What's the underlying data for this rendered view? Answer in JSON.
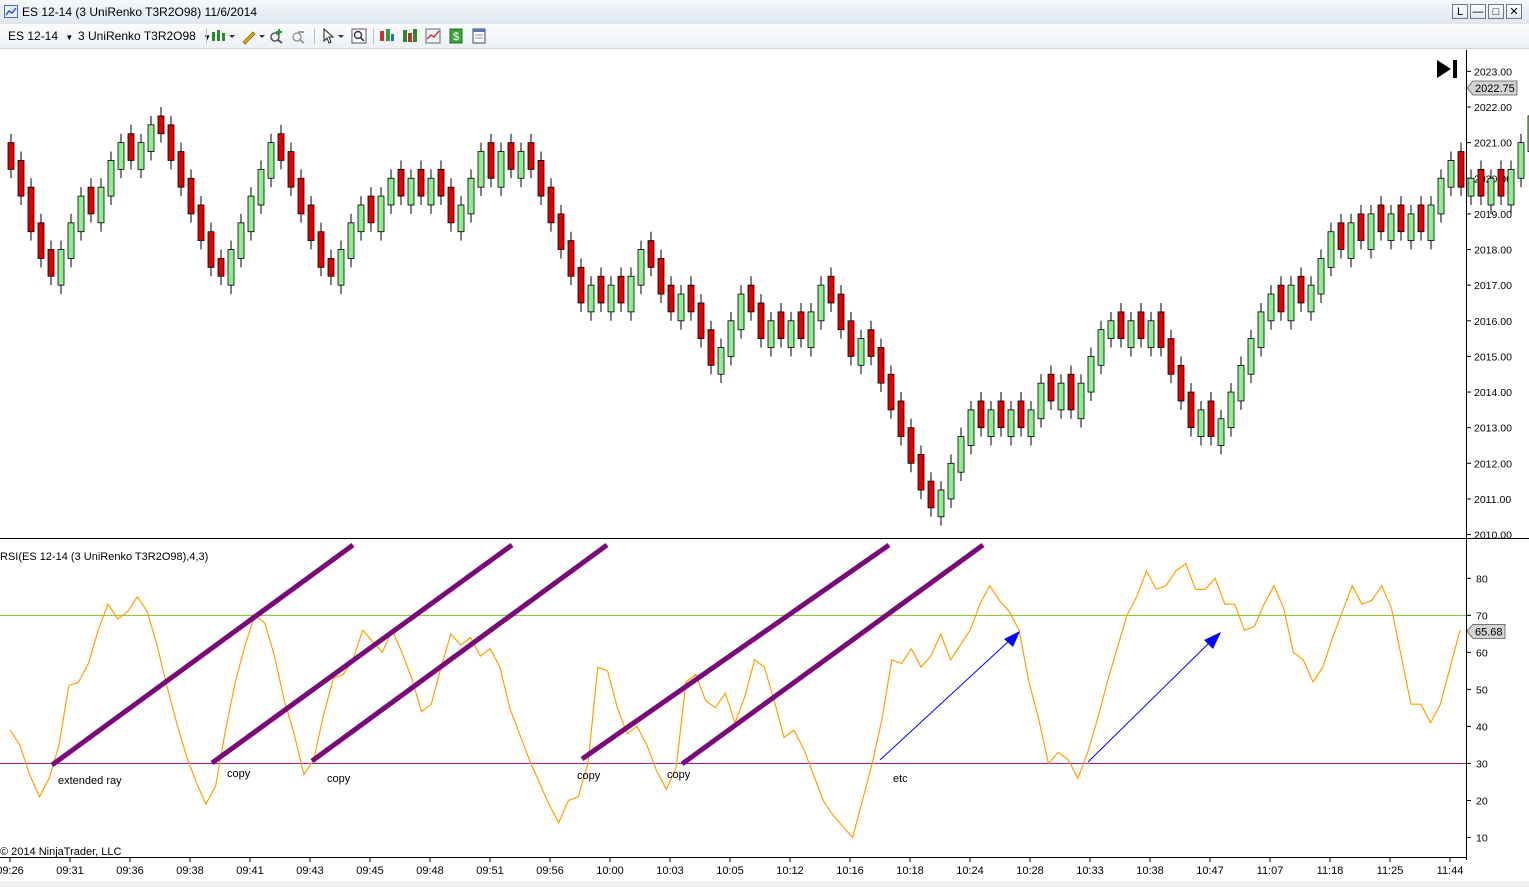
{
  "window": {
    "title": "ES 12-14 (3 UniRenko T3R2O98)  11/6/2014",
    "buttons": [
      "L",
      "—",
      "□",
      "✕"
    ]
  },
  "toolbar": {
    "instrument": "ES 12-14",
    "bar_type": "3 UniRenko T3R2O98",
    "icons": [
      "chart-style-icon",
      "drawing-pencil-icon",
      "zoom-in-icon",
      "zoom-out-icon",
      "pointer-icon",
      "properties-icon",
      "data-box-icon",
      "indicators-icon",
      "strategies-icon",
      "dollar-icon",
      "templates-icon"
    ]
  },
  "chart_data": [
    {
      "type": "candlestick",
      "title": "ES 12-14 (3 UniRenko T3R2O98)",
      "y_ticks": [
        "2010.00",
        "2011.00",
        "2012.00",
        "2013.00",
        "2014.00",
        "2015.00",
        "2016.00",
        "2017.00",
        "2018.00",
        "2019.00",
        "2020.00",
        "2021.00",
        "2022.00",
        "2023.00"
      ],
      "ylim": [
        2009.96,
        2023.6
      ],
      "last_price": "2022.75",
      "closes": [
        2020.25,
        2019.5,
        2018.5,
        2017.75,
        2017.25,
        2018.0,
        2018.75,
        2019.5,
        2019.0,
        2019.75,
        2020.5,
        2021.0,
        2020.5,
        2021.0,
        2021.5,
        2021.25,
        2020.5,
        2019.75,
        2019.0,
        2018.25,
        2017.5,
        2017.25,
        2018.0,
        2018.75,
        2019.5,
        2020.25,
        2021.0,
        2020.5,
        2019.75,
        2019.0,
        2018.25,
        2017.5,
        2017.25,
        2018.0,
        2018.75,
        2019.25,
        2018.75,
        2019.5,
        2020.0,
        2019.5,
        2020.0,
        2019.5,
        2020.0,
        2019.5,
        2018.75,
        2019.25,
        2020.0,
        2020.75,
        2020.0,
        2020.75,
        2020.25,
        2020.75,
        2020.25,
        2019.5,
        2018.75,
        2018.0,
        2017.25,
        2016.5,
        2017.0,
        2016.5,
        2017.0,
        2016.5,
        2017.25,
        2018.0,
        2017.5,
        2016.75,
        2016.25,
        2016.75,
        2016.25,
        2015.5,
        2014.75,
        2015.25,
        2016.0,
        2016.75,
        2016.25,
        2015.5,
        2016.0,
        2015.5,
        2016.0,
        2015.5,
        2016.25,
        2017.0,
        2016.5,
        2015.75,
        2015.0,
        2015.5,
        2015.0,
        2014.25,
        2013.5,
        2012.75,
        2012.0,
        2011.25,
        2010.75,
        2011.25,
        2012.0,
        2012.75,
        2013.5,
        2013.0,
        2013.5,
        2013.0,
        2013.5,
        2013.0,
        2013.5,
        2014.25,
        2013.75,
        2014.25,
        2013.5,
        2014.25,
        2015.0,
        2015.75,
        2016.0,
        2015.5,
        2016.0,
        2015.5,
        2016.0,
        2015.25,
        2014.5,
        2013.75,
        2013.0,
        2013.5,
        2012.75,
        2013.25,
        2014.0,
        2014.75,
        2015.5,
        2016.25,
        2016.75,
        2016.25,
        2017.0,
        2016.5,
        2017.0,
        2017.75,
        2018.5,
        2018.0,
        2018.75,
        2018.25,
        2019.0,
        2018.5,
        2019.0,
        2018.5,
        2019.0,
        2018.5,
        2019.25,
        2020.0,
        2020.5,
        2019.75,
        2020.0,
        2019.5,
        2020.0,
        2019.5,
        2020.25,
        2021.0,
        2021.75,
        2021.25,
        2022.0,
        2021.5,
        2022.25,
        2022.75,
        2022.25,
        2021.5,
        2020.75,
        2021.25,
        2020.75,
        2021.25,
        2021.5,
        2022.0,
        2022.75
      ]
    },
    {
      "type": "line",
      "title": "RSI(ES 12-14 (3 UniRenko T3R2O98),4,3)",
      "y_ticks": [
        "10",
        "20",
        "30",
        "40",
        "50",
        "60",
        "70",
        "80"
      ],
      "ylim": [
        5,
        89
      ],
      "last_value": "65.68",
      "levels": [
        30,
        70
      ],
      "values": [
        39,
        35,
        27,
        21,
        26,
        35,
        51,
        52,
        57,
        66,
        73,
        69,
        71,
        75,
        71,
        62,
        51,
        41,
        32,
        25,
        19,
        24,
        39,
        52,
        62,
        70,
        68,
        59,
        47,
        38,
        27,
        31,
        43,
        53,
        54,
        58,
        66,
        63,
        60,
        66,
        60,
        53,
        44,
        46,
        56,
        65,
        62,
        64,
        59,
        61,
        56,
        45,
        38,
        31,
        25,
        19,
        14,
        20,
        21,
        30,
        56,
        55,
        45,
        38,
        40,
        35,
        28,
        23,
        29,
        52,
        54,
        47,
        45,
        49,
        41,
        48,
        58,
        56,
        47,
        37,
        39,
        34,
        27,
        20,
        16,
        13,
        10,
        20,
        30,
        42,
        58,
        57,
        61,
        56,
        59,
        65,
        58,
        62,
        66,
        73,
        78,
        74,
        71,
        66,
        52,
        42,
        30,
        33,
        31,
        26,
        33,
        42,
        52,
        61,
        70,
        75,
        82,
        77,
        78,
        82,
        84,
        77,
        77,
        80,
        73,
        73,
        66,
        67,
        73,
        78,
        72,
        60,
        58,
        52,
        56,
        64,
        71,
        78,
        73,
        74,
        78,
        72,
        59,
        46,
        46,
        41,
        46,
        56,
        66
      ]
    }
  ],
  "x_axis": {
    "labels": [
      "09:26",
      "09:31",
      "09:36",
      "09:38",
      "09:41",
      "09:43",
      "09:45",
      "09:48",
      "09:51",
      "09:56",
      "10:00",
      "10:03",
      "10:05",
      "10:12",
      "10:16",
      "10:18",
      "10:24",
      "10:28",
      "10:33",
      "10:38",
      "10:47",
      "11:07",
      "11:18",
      "11:25",
      "11:44"
    ]
  },
  "annotations": {
    "labels": [
      "extended ray",
      "copy",
      "copy",
      "copy",
      "copy",
      "etc"
    ]
  },
  "colors": {
    "up_candle": "#90ee90",
    "down_candle": "#e00000",
    "rsi_line": "#ffa000",
    "level_70": "#7fbf2f",
    "level_30": "#a020a0",
    "ray": "#7a0a7a",
    "arrow": "#0000ff"
  },
  "copyright": "© 2014 NinjaTrader, LLC"
}
